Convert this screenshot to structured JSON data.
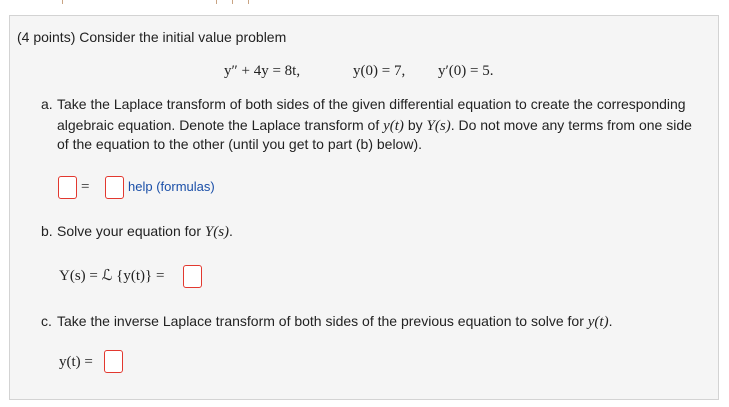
{
  "problem": {
    "header": "(4 points) Consider the initial value problem",
    "ode": "y″ + 4y = 8t,",
    "ic1": "y(0) = 7,",
    "ic2": "y′(0) = 5."
  },
  "part_a": {
    "marker": "a.",
    "line1_pre": "Take the Laplace transform of both sides of the given differential equation to create the corresponding",
    "line2_a": "algebraic equation. Denote the Laplace transform of ",
    "line2_y": "y(t)",
    "line2_b": " by ",
    "line2_Y": "Y(s)",
    "line2_c": ". Do not move any terms from one side",
    "line3": "of the equation to the other (until you get to part (b) below).",
    "equals": "=",
    "help_label": "help (formulas)"
  },
  "part_b": {
    "marker": "b.",
    "prompt_text": "Solve your equation for ",
    "prompt_math": "Y(s)",
    "prompt_end": ".",
    "formula": "Y(s) = ℒ {y(t)} ="
  },
  "part_c": {
    "marker": "c.",
    "prompt_text": "Take the inverse Laplace transform of both sides of the previous equation to solve for ",
    "prompt_math": "y(t)",
    "prompt_end": ".",
    "formula": "y(t) ="
  },
  "colors": {
    "box_background": "#f5f5f5",
    "box_border": "#d3d3d3",
    "answer_border": "#e2382f",
    "link": "#1a4fa8"
  }
}
